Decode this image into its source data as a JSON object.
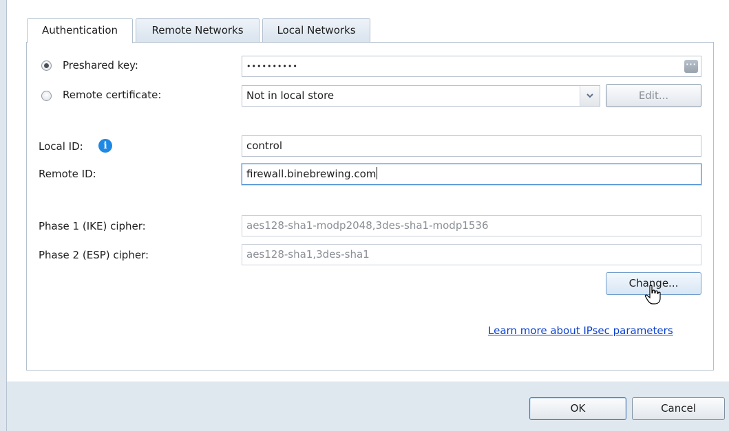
{
  "tabs": [
    {
      "label": "Authentication",
      "active": true
    },
    {
      "label": "Remote Networks",
      "active": false
    },
    {
      "label": "Local Networks",
      "active": false
    }
  ],
  "auth": {
    "preshared_label": "Preshared key:",
    "preshared_value": "••••••••••",
    "remote_cert_label": "Remote certificate:",
    "remote_cert_value": "Not in local store",
    "edit_label": "Edit...",
    "local_id_label": "Local ID:",
    "local_id_value": "control",
    "remote_id_label": "Remote ID:",
    "remote_id_value": "firewall.binebrewing.com",
    "phase1_label": "Phase 1 (IKE) cipher:",
    "phase1_value": "aes128-sha1-modp2048,3des-sha1-modp1536",
    "phase2_label": "Phase 2 (ESP) cipher:",
    "phase2_value": "aes128-sha1,3des-sha1",
    "change_label": "Change...",
    "learn_more": "Learn more about IPsec parameters"
  },
  "dialog": {
    "ok_label": "OK",
    "cancel_label": "Cancel"
  },
  "colors": {
    "accent": "#4e8fd6",
    "info": "#1e88e5",
    "link": "#0a3fd0"
  }
}
